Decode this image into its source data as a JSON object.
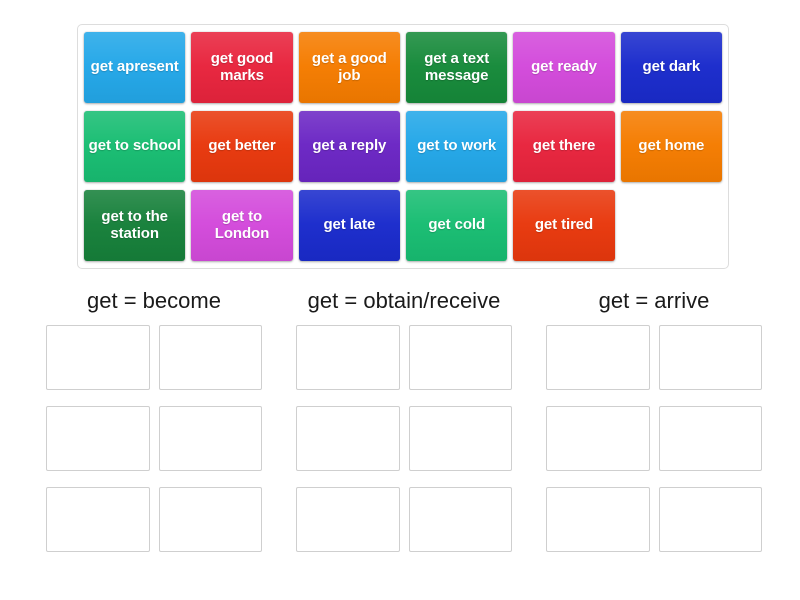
{
  "activity": {
    "type": "group-sort",
    "tray": {
      "name": "draggable-tile-tray",
      "tiles": [
        {
          "label": "get apresent",
          "color": "#23a7e8"
        },
        {
          "label": "get good marks",
          "color": "#e8243d"
        },
        {
          "label": "get a good job",
          "color": "#f57c00"
        },
        {
          "label": "get a text message",
          "color": "#168a3a"
        },
        {
          "label": "get ready",
          "color": "#d34adb"
        },
        {
          "label": "get dark",
          "color": "#1a2bcc"
        },
        {
          "label": "get to school",
          "color": "#18bd72"
        },
        {
          "label": "get better",
          "color": "#e8380d"
        },
        {
          "label": "get a reply",
          "color": "#6b26c4"
        },
        {
          "label": "get to work",
          "color": "#23a7e8"
        },
        {
          "label": "get there",
          "color": "#e8243d"
        },
        {
          "label": "get home",
          "color": "#f57c00"
        },
        {
          "label": "get to the station",
          "color": "#16803a"
        },
        {
          "label": "get to London",
          "color": "#d34adb"
        },
        {
          "label": "get late",
          "color": "#1a2bcc"
        },
        {
          "label": "get cold",
          "color": "#18bd72"
        },
        {
          "label": "get tired",
          "color": "#e8380d"
        }
      ]
    },
    "categories": [
      {
        "title": "get = become",
        "slot_count": 6
      },
      {
        "title": "get = obtain/receive",
        "slot_count": 6
      },
      {
        "title": "get = arrive",
        "slot_count": 6
      }
    ]
  }
}
